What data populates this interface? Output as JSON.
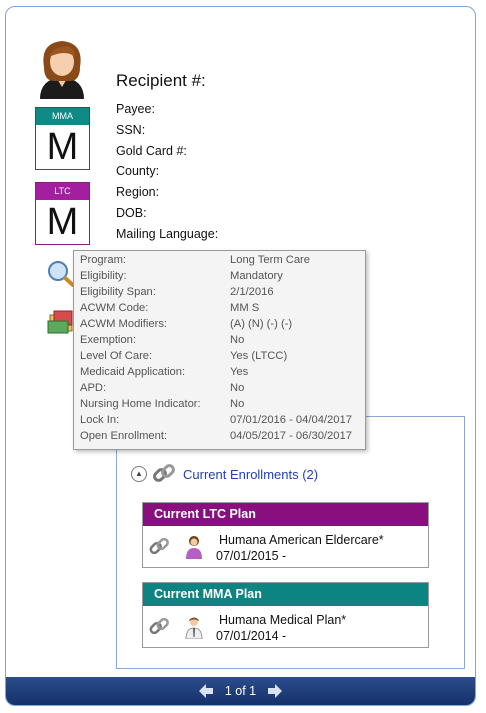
{
  "header": {
    "title": "Recipient #:"
  },
  "fields": [
    {
      "label": "Payee:"
    },
    {
      "label": "SSN:"
    },
    {
      "label": "Gold Card #:"
    },
    {
      "label": "County:"
    },
    {
      "label": "Region:"
    },
    {
      "label": "DOB:"
    },
    {
      "label": "Mailing Language:"
    }
  ],
  "badges": {
    "mma": {
      "band": "MMA",
      "letter": "M",
      "color": "#0f8a86"
    },
    "ltc": {
      "band": "LTC",
      "letter": "M",
      "color": "#a31fa0"
    }
  },
  "tooltip": [
    {
      "label": "Program:",
      "value": "Long Term Care"
    },
    {
      "label": "Eligibility:",
      "value": "Mandatory"
    },
    {
      "label": "Eligibility Span:",
      "value": "2/1/2016"
    },
    {
      "label": "ACWM Code:",
      "value": "MM S"
    },
    {
      "label": "ACWM Modifiers:",
      "value": "(A) (N) (-) (-)"
    },
    {
      "label": "Exemption:",
      "value": "No"
    },
    {
      "label": "Level Of Care:",
      "value": "Yes (LTCC)"
    },
    {
      "label": "Medicaid Application:",
      "value": "Yes"
    },
    {
      "label": "APD:",
      "value": "No"
    },
    {
      "label": "Nursing Home Indicator:",
      "value": "No"
    },
    {
      "label": "Lock In:",
      "value": "07/01/2016 - 04/04/2017"
    },
    {
      "label": "Open Enrollment:",
      "value": "04/05/2017 - 06/30/2017"
    }
  ],
  "enrollments": {
    "link": "Current Enrollments (2)",
    "plans": [
      {
        "header": "Current LTC Plan",
        "name": "Humana American Eldercare*",
        "date": "07/01/2015 -",
        "color": "#8a0f7e"
      },
      {
        "header": "Current MMA Plan",
        "name": "Humana Medical Plan*",
        "date": "07/01/2014 -",
        "color": "#0c8481"
      }
    ]
  },
  "pagination": {
    "label": "1 of 1"
  }
}
